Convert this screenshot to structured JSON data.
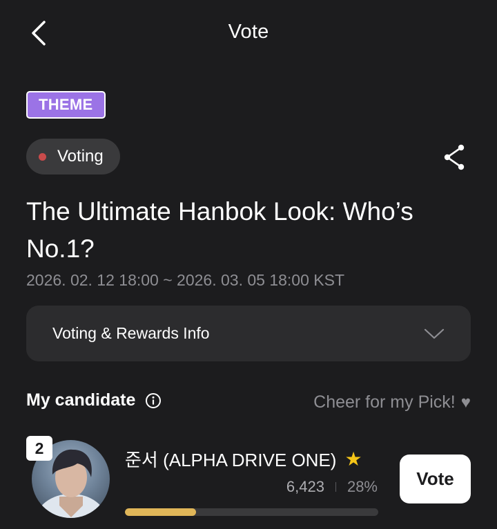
{
  "header": {
    "title": "Vote",
    "back_icon": "chevron-left-icon"
  },
  "vote": {
    "theme_badge": "THEME",
    "status": "Voting",
    "status_color": "#c94b4b",
    "title": "The Ultimate Hanbok Look: Who’s No.1?",
    "period": "2026. 02. 12 18:00 ~ 2026. 03. 05 18:00 KST",
    "share_icon": "share-icon"
  },
  "info_panel": {
    "label": "Voting & Rewards Info",
    "icon": "chevron-down-icon"
  },
  "my_candidate": {
    "title": "My candidate",
    "info_icon": "info-icon",
    "cheer_text": "Cheer for my Pick!",
    "cheer_icon": "♥"
  },
  "candidate": {
    "rank": "2",
    "name": "준서 (ALPHA DRIVE ONE)",
    "star_icon": "★",
    "votes": "6,423",
    "percent": "28%",
    "progress": 0.28,
    "vote_button": "Vote"
  },
  "colors": {
    "background": "#1c1c1e",
    "theme_badge": "#9b73e6",
    "progress_fill": "#e0b659",
    "star": "#f5c518"
  }
}
